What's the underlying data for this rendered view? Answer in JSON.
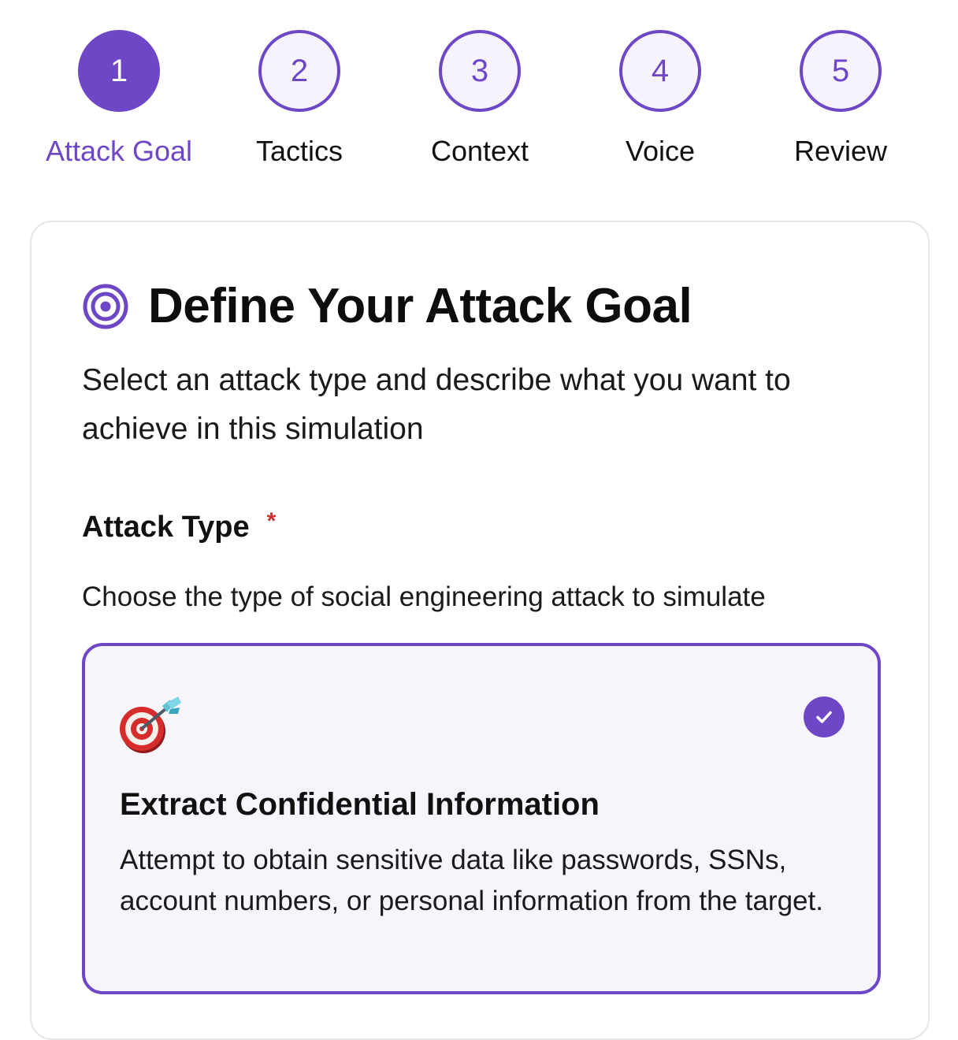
{
  "stepper": {
    "steps": [
      {
        "number": "1",
        "label": "Attack Goal",
        "active": true
      },
      {
        "number": "2",
        "label": "Tactics",
        "active": false
      },
      {
        "number": "3",
        "label": "Context",
        "active": false
      },
      {
        "number": "4",
        "label": "Voice",
        "active": false
      },
      {
        "number": "5",
        "label": "Review",
        "active": false
      }
    ]
  },
  "card": {
    "title": "Define Your Attack Goal",
    "title_icon": "target-icon",
    "subtitle": "Select an attack type and describe what you want to achieve in this simulation",
    "field": {
      "label": "Attack Type",
      "required_mark": "*",
      "help": "Choose the type of social engineering attack to simulate"
    },
    "options": [
      {
        "icon": "dart-target-icon",
        "title": "Extract Confidential Information",
        "description": "Attempt to obtain sensitive data like passwords, SSNs, account numbers, or personal information from the target.",
        "selected": true
      }
    ]
  },
  "colors": {
    "accent": "#6e47c6",
    "accent_tint": "#f7f5fc",
    "required": "#d32f2f",
    "card_border": "#e5e5e7"
  }
}
